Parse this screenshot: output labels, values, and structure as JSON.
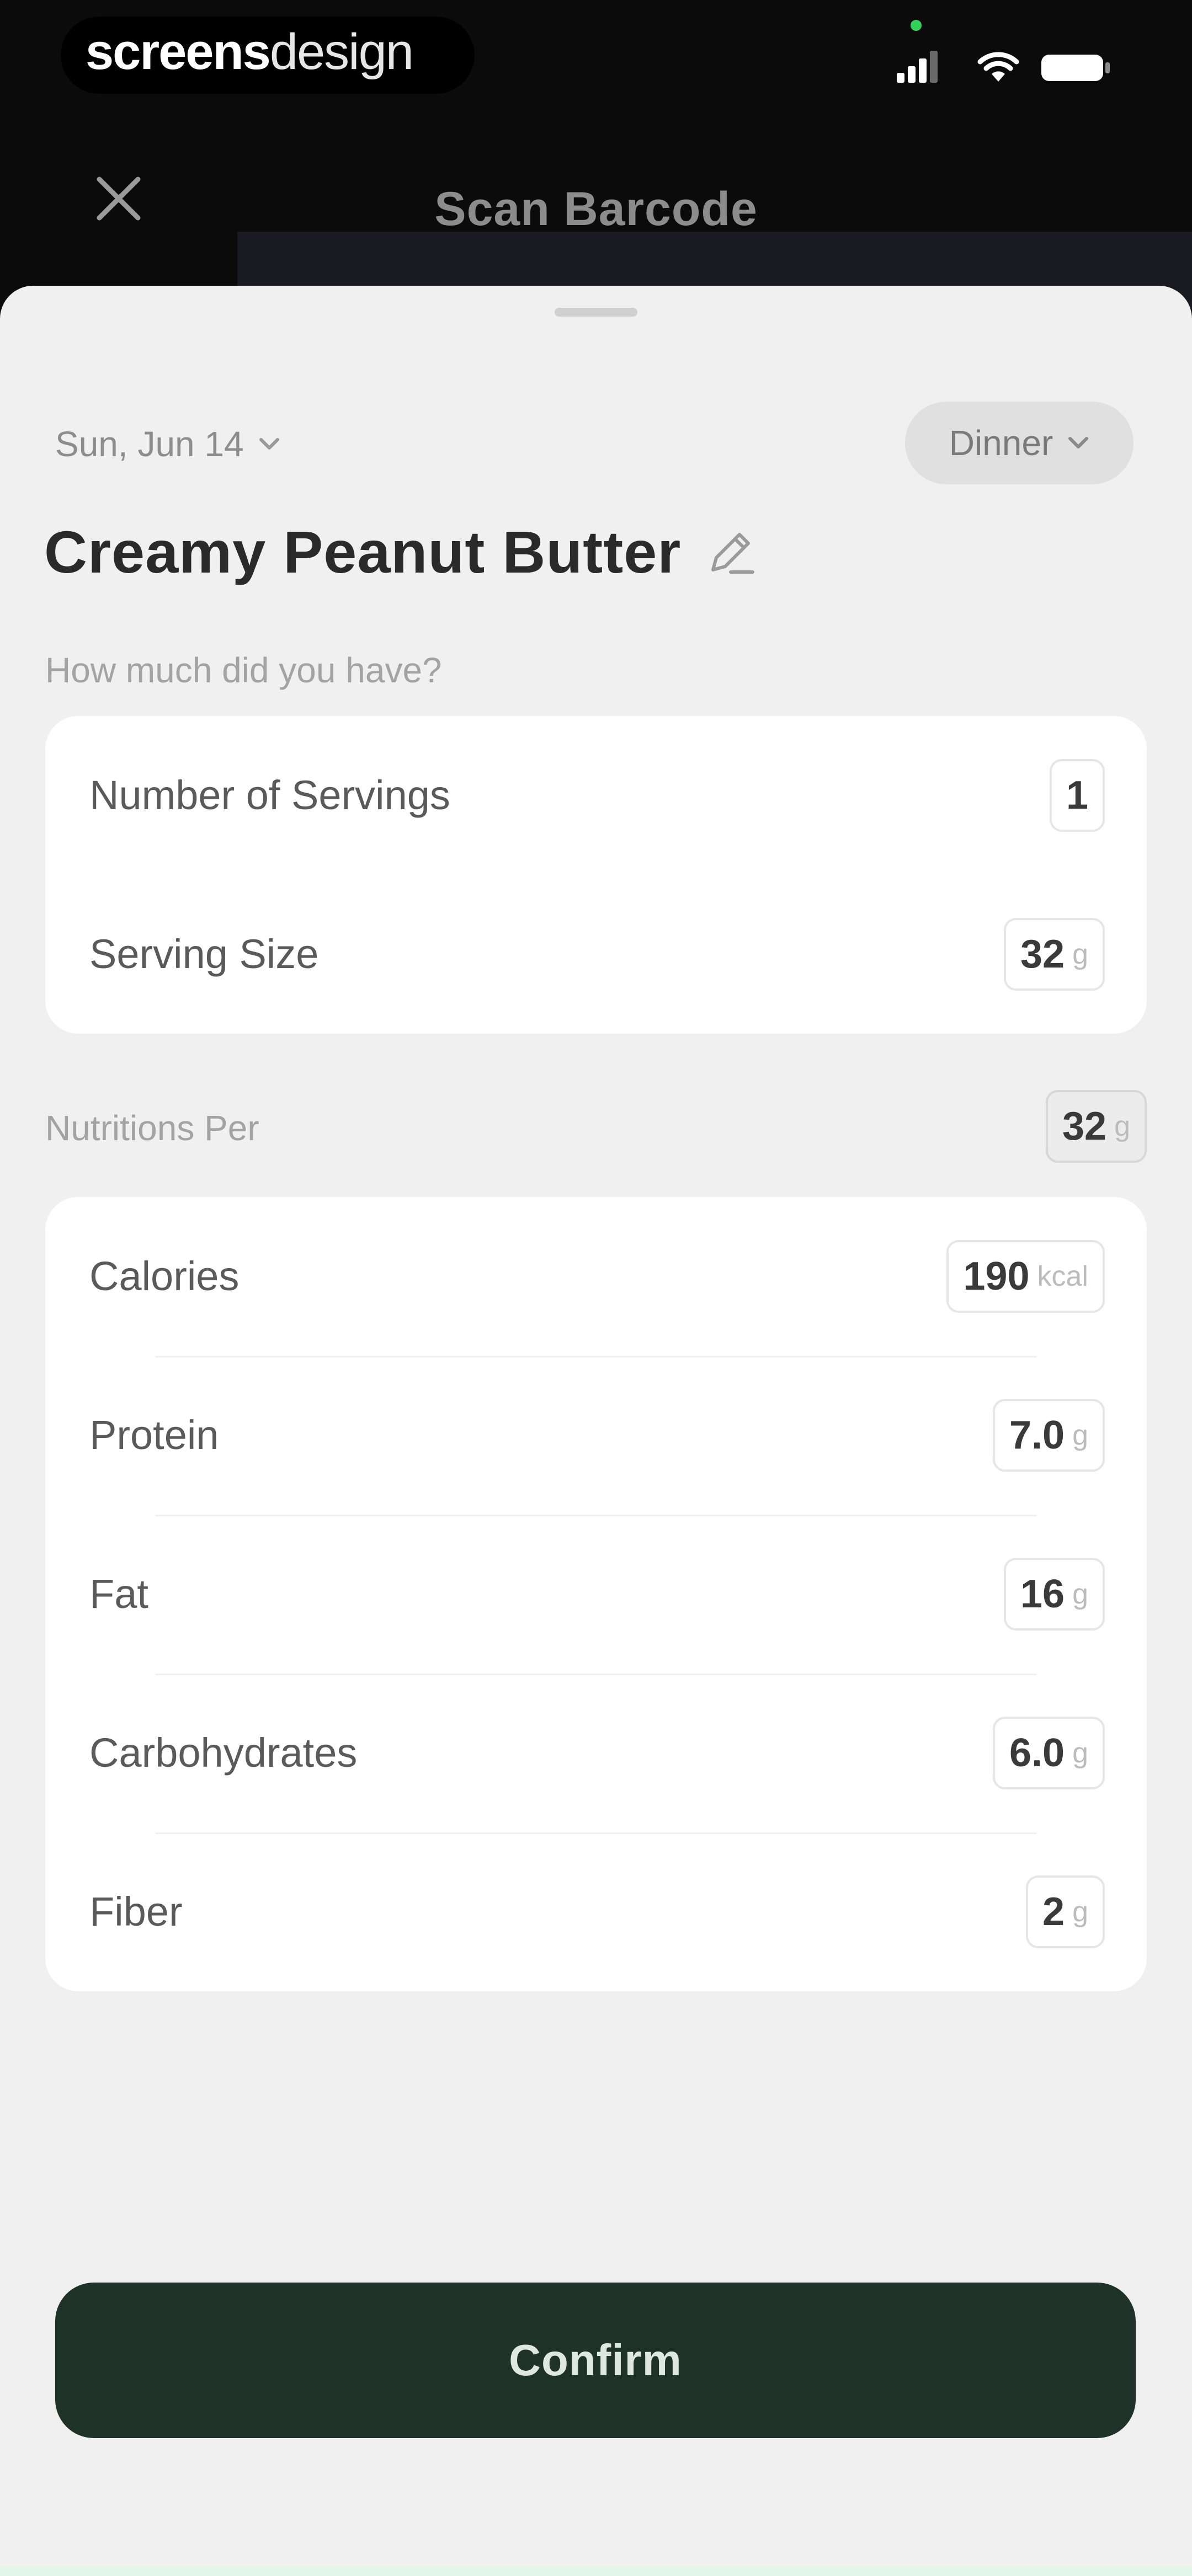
{
  "status_bar": {
    "brand_bold": "screens",
    "brand_light": "design"
  },
  "header": {
    "title": "Scan Barcode"
  },
  "sheet": {
    "date": "Sun, Jun 14",
    "meal": "Dinner",
    "food_name": "Creamy Peanut Butter",
    "amount_section_label": "How much did you have?",
    "servings": {
      "label": "Number of Servings",
      "value": "1"
    },
    "serving_size": {
      "label": "Serving Size",
      "value": "32",
      "unit": "g"
    },
    "nutrition_per": {
      "label": "Nutritions Per",
      "value": "32",
      "unit": "g"
    },
    "nutrients": [
      {
        "label": "Calories",
        "value": "190",
        "unit": "kcal"
      },
      {
        "label": "Protein",
        "value": "7.0",
        "unit": "g"
      },
      {
        "label": "Fat",
        "value": "16",
        "unit": "g"
      },
      {
        "label": "Carbohydrates",
        "value": "6.0",
        "unit": "g"
      },
      {
        "label": "Fiber",
        "value": "2",
        "unit": "g"
      }
    ],
    "confirm_label": "Confirm"
  },
  "colors": {
    "confirm_bg": "#1e3229",
    "sheet_bg": "#f0f0f0",
    "card_bg": "#ffffff"
  },
  "icons": [
    "close-icon",
    "signal-icon",
    "wifi-icon",
    "battery-icon",
    "chevron-down-icon",
    "pencil-icon"
  ]
}
